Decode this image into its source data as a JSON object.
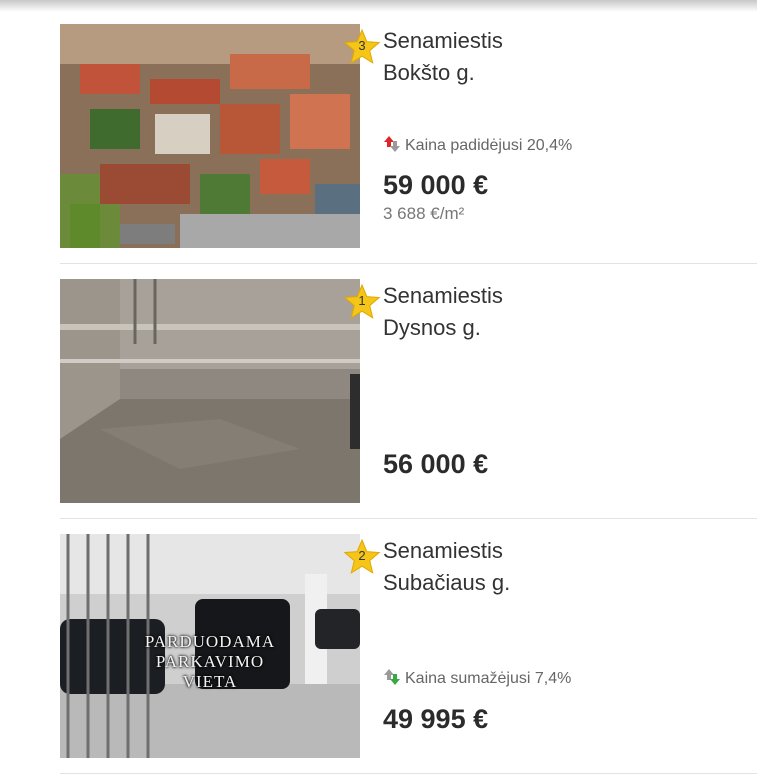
{
  "listings": [
    {
      "rank": "3",
      "district": "Senamiestis",
      "street": "Bokšto g.",
      "change": {
        "direction": "up",
        "text": "Kaina padidėjusi 20,4%"
      },
      "price": "59 000 €",
      "price_per_sqm": "3 688 €/m²",
      "photo": "aerial-old-town"
    },
    {
      "rank": "1",
      "district": "Senamiestis",
      "street": "Dysnos g.",
      "price": "56 000 €",
      "photo": "underground-parking-empty"
    },
    {
      "rank": "2",
      "district": "Senamiestis",
      "street": "Subačiaus g.",
      "change": {
        "direction": "down",
        "text": "Kaina sumažėjusi 7,4%"
      },
      "price": "49 995 €",
      "photo": "underground-parking-cars",
      "photo_caption": [
        "PARDUODAMA",
        "PARKAVIMO",
        "VIETA"
      ]
    }
  ],
  "colors": {
    "star": "#f5c518",
    "arrow_up": "#e0242b",
    "arrow_down": "#3aa845",
    "arrow_neutral": "#9a9a9a"
  }
}
